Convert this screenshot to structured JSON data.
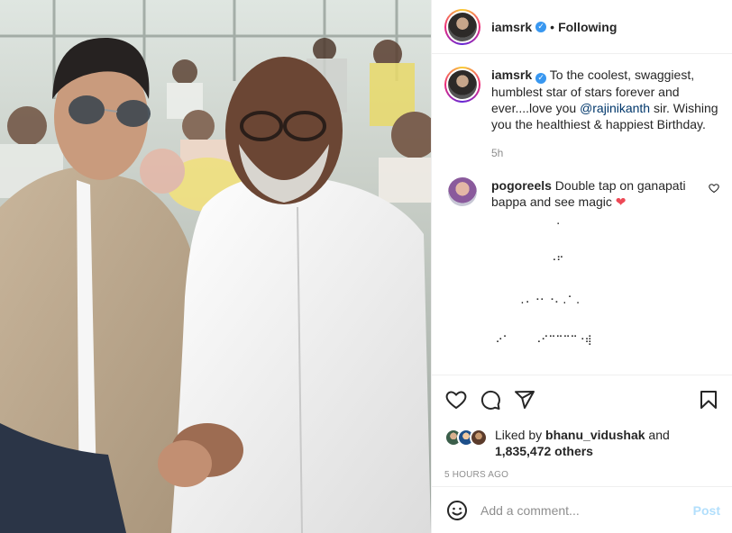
{
  "header": {
    "username": "iamsrk",
    "separator": "•",
    "follow_status": "Following"
  },
  "caption": {
    "username": "iamsrk",
    "text_before_mention": " To the coolest, swaggiest, humblest star of stars forever and ever....love you ",
    "mention": "@rajinikanth",
    "text_after_mention": " sir. Wishing you the healthiest & happiest Birthday.",
    "time": "5h"
  },
  "comments": [
    {
      "username": "pogoreels",
      "text": " Double tap on ganapati bappa and see magic ",
      "emoji": "❤",
      "art": "           .\n\n          ⠐⠋\n\n     .⠄⠐⠂⠐⠄.⠁.\n\n ⠔⠁    ⠠⠊⠉⠉⠉⠉⠐⢾\n\n ⠠⠋⠑.. ⠠⠊⠉⠉⠉⠉⠢⠐⠄"
    }
  ],
  "likes": {
    "prefix": "Liked by ",
    "user": "bhanu_vidushak",
    "middle": " and",
    "count": "1,835,472 others"
  },
  "timestamp": "5 HOURS AGO",
  "comment_input": {
    "placeholder": "Add a comment...",
    "post_label": "Post"
  }
}
